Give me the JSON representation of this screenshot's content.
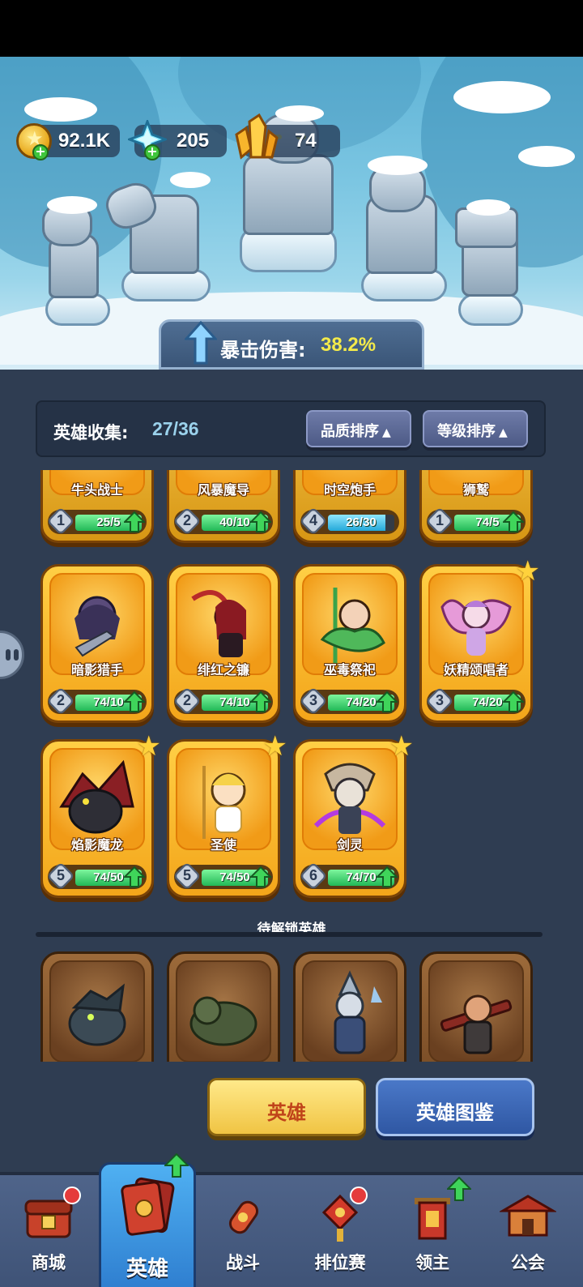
{
  "currency": {
    "gold": "92.1K",
    "gems": "205",
    "crystals": "74"
  },
  "banner": {
    "crit_label": "暴击伤害:",
    "crit_value": "38.2%"
  },
  "collection": {
    "label": "英雄收集:",
    "count": "27/36",
    "sort_quality": "品质排序",
    "sort_level": "等级排序"
  },
  "heroes": [
    {
      "name": "牛头战士",
      "level": "1",
      "progress": "25/5",
      "fill": 1.0,
      "upgradable": true,
      "starred": false
    },
    {
      "name": "风暴魔导",
      "level": "2",
      "progress": "40/10",
      "fill": 1.0,
      "upgradable": true,
      "starred": false
    },
    {
      "name": "时空炮手",
      "level": "4",
      "progress": "26/30",
      "fill": 0.87,
      "upgradable": false,
      "starred": false
    },
    {
      "name": "狮鹫",
      "level": "1",
      "progress": "74/5",
      "fill": 1.0,
      "upgradable": true,
      "starred": false
    },
    {
      "name": "暗影猎手",
      "level": "2",
      "progress": "74/10",
      "fill": 1.0,
      "upgradable": true,
      "starred": false
    },
    {
      "name": "绯红之镰",
      "level": "2",
      "progress": "74/10",
      "fill": 1.0,
      "upgradable": true,
      "starred": false
    },
    {
      "name": "巫毒祭祀",
      "level": "3",
      "progress": "74/20",
      "fill": 1.0,
      "upgradable": true,
      "starred": false
    },
    {
      "name": "妖精颂唱者",
      "level": "3",
      "progress": "74/20",
      "fill": 1.0,
      "upgradable": true,
      "starred": true
    },
    {
      "name": "焰影魔龙",
      "level": "5",
      "progress": "74/50",
      "fill": 1.0,
      "upgradable": true,
      "starred": true
    },
    {
      "name": "圣使",
      "level": "5",
      "progress": "74/50",
      "fill": 1.0,
      "upgradable": true,
      "starred": true
    },
    {
      "name": "剑灵",
      "level": "6",
      "progress": "74/70",
      "fill": 1.0,
      "upgradable": true,
      "starred": true
    }
  ],
  "locked": {
    "title": "待解锁英雄"
  },
  "buttons": {
    "hero": "英雄",
    "codex": "英雄图鉴"
  },
  "nav": [
    {
      "label": "商城",
      "icon": "shop-chest-icon"
    },
    {
      "label": "英雄",
      "icon": "hero-cards-icon"
    },
    {
      "label": "战斗",
      "icon": "battle-rocket-icon"
    },
    {
      "label": "排位赛",
      "icon": "ranked-knot-icon"
    },
    {
      "label": "领主",
      "icon": "lord-banner-icon"
    },
    {
      "label": "公会",
      "icon": "guild-temple-icon"
    }
  ],
  "colors": {
    "panel_bg": "#2f3d52",
    "card_gold": "#f3a51a",
    "progress_green": "#22b857",
    "crit_yellow": "#f3ea4a",
    "nav_active": "#2f7fd0"
  }
}
